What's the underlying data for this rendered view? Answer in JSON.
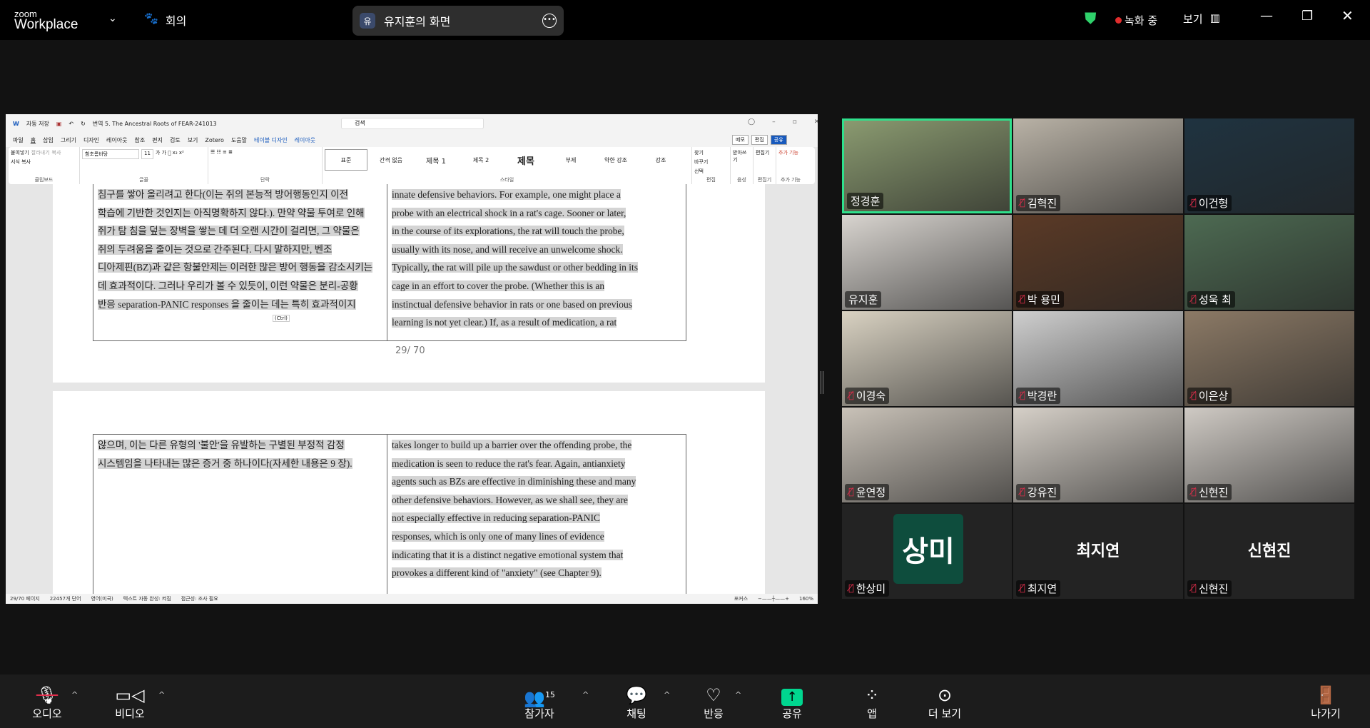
{
  "topbar": {
    "brand_top": "zoom",
    "brand_bottom": "Workplace",
    "meeting_label": "회의",
    "share_avatar": "유",
    "share_title": "유지훈의 화면",
    "recording": "녹화 중",
    "view_label": "보기"
  },
  "word": {
    "title_left": "자동 저장",
    "doc_title": "번역 5. The Ancestral Roots of FEAR-241013",
    "search_placeholder": "검색",
    "menu": [
      "파일",
      "홈",
      "삽입",
      "그리기",
      "디자인",
      "레이아웃",
      "참조",
      "편지",
      "검토",
      "보기",
      "Zotero",
      "도움말",
      "테이블 디자인",
      "레이아웃"
    ],
    "right_buttons": [
      "메모",
      "편집",
      "공유"
    ],
    "ribbon_groups": [
      "클립보드",
      "글꼴",
      "단락",
      "스타일",
      "편집",
      "음성",
      "편집기",
      "추가 기능"
    ],
    "clipboard": [
      "붙여넣기",
      "잘라내기",
      "복사",
      "서식 복사"
    ],
    "font": "함초롬바탕",
    "size": "11",
    "styles": [
      "표준",
      "간격 없음",
      "제목 1",
      "제목 2",
      "제목",
      "부제",
      "약한 강조",
      "강조"
    ],
    "edit": [
      "찾기",
      "바꾸기",
      "선택"
    ],
    "voice": "받아쓰기",
    "editor": "편집기",
    "addins": "추가 기능",
    "page1": {
      "korean": [
        "침구를 쌓아 올리려고 한다(이는 쥐의 본능적 방어행동인지 이전",
        "학습에 기반한 것인지는 아직명확하지 않다.). 만약 약물 투여로 인해",
        "쥐가 탐 침을 덮는 장벽을 쌓는 데 더 오랜 시간이 걸리면, 그 약물은",
        "쥐의 두려움을 줄이는 것으로 간주된다. 다시 말하지만, 벤조",
        "디아제핀(BZ)과 같은 항불안제는 이러한 많은 방어 행동을 감소시키는",
        "데 효과적이다. 그러나 우리가 볼 수 있듯이, 이런 약물은 분리-공황",
        "반응 separation-PANIC responses 을 줄이는 데는 특히 효과적이지"
      ],
      "english": [
        "innate defensive behaviors. For example, one might place a",
        "probe with an electrical shock in a rat's cage. Sooner or later,",
        "in the course of its explorations, the rat will touch the probe,",
        "usually with its nose, and will receive an unwelcome shock.",
        "Typically, the rat will pile up the sawdust or other bedding in its",
        "cage in an effort to cover the probe. (Whether this is an",
        "instinctual defensive behavior in rats or one based on previous",
        "learning is not yet clear.) If, as a result of medication, a rat"
      ],
      "paste_tag": "(Ctrl)",
      "page_number": "29/ 70"
    },
    "page2": {
      "korean": [
        "않으며, 이는 다른 유형의 '불안'을 유발하는 구별된 부정적 감정",
        "시스템임을 나타내는 많은 증거 중 하나이다(자세한 내용은 9 장)."
      ],
      "english": [
        "takes longer to build up a barrier over the offending probe, the",
        "medication is seen to reduce the rat's fear. Again, antianxiety",
        "agents such as BZs are effective in diminishing these and many",
        "other defensive behaviors. However, as we shall see, they are",
        "not especially effective in reducing separation-PANIC",
        "responses, which is only one of many lines of evidence",
        "indicating that it is a distinct negative emotional system that",
        "provokes a different kind of \"anxiety\" (see Chapter 9)."
      ]
    },
    "status": {
      "page": "29/70 페이지",
      "words": "22457개 단어",
      "lang": "영어(미국)",
      "autocomplete": "텍스트 자동 완성: 켜짐",
      "access": "접근성: 조사 필요",
      "focus": "포커스",
      "zoom": "160%"
    }
  },
  "gallery": [
    {
      "name": "정경훈",
      "muted": false,
      "active": true,
      "bg": "#8a9a70"
    },
    {
      "name": "김혁진",
      "muted": true,
      "bg": "#b9b2a6"
    },
    {
      "name": "이건형",
      "muted": true,
      "bg": "#1f3340"
    },
    {
      "name": "유지훈",
      "muted": false,
      "bg": "#d8d4cf"
    },
    {
      "name": "박 용민",
      "muted": true,
      "bg": "#5b3a26"
    },
    {
      "name": "성욱 최",
      "muted": true,
      "bg": "#4d6a52"
    },
    {
      "name": "이경숙",
      "muted": true,
      "bg": "#d9d2c2"
    },
    {
      "name": "박경란",
      "muted": true,
      "bg": "#cfcfcf"
    },
    {
      "name": "이은상",
      "muted": true,
      "bg": "#8c7a66"
    },
    {
      "name": "윤연정",
      "muted": true,
      "bg": "#c9c2b8"
    },
    {
      "name": "강유진",
      "muted": true,
      "bg": "#d6d0c8"
    },
    {
      "name": "신현진",
      "muted": true,
      "bg": "#cfcac4"
    },
    {
      "name": "한상미",
      "muted": true,
      "avatar": "상미",
      "bg": "#232323"
    },
    {
      "name": "최지연",
      "muted": true,
      "big": "최지연",
      "bg": "#232323"
    },
    {
      "name": "신현진",
      "muted": true,
      "big": "신현진",
      "bg": "#232323"
    }
  ],
  "toolbar": {
    "audio": "오디오",
    "video": "비디오",
    "participants": "참가자",
    "participants_count": "15",
    "chat": "채팅",
    "react": "반응",
    "share": "공유",
    "apps": "앱",
    "more": "더 보기",
    "leave": "나가기"
  },
  "colors": {
    "active_border": "#2fe08c",
    "share_green": "#00d68f",
    "muted_red": "#e02d4b",
    "avatar_bg": "#0e4d3d"
  }
}
